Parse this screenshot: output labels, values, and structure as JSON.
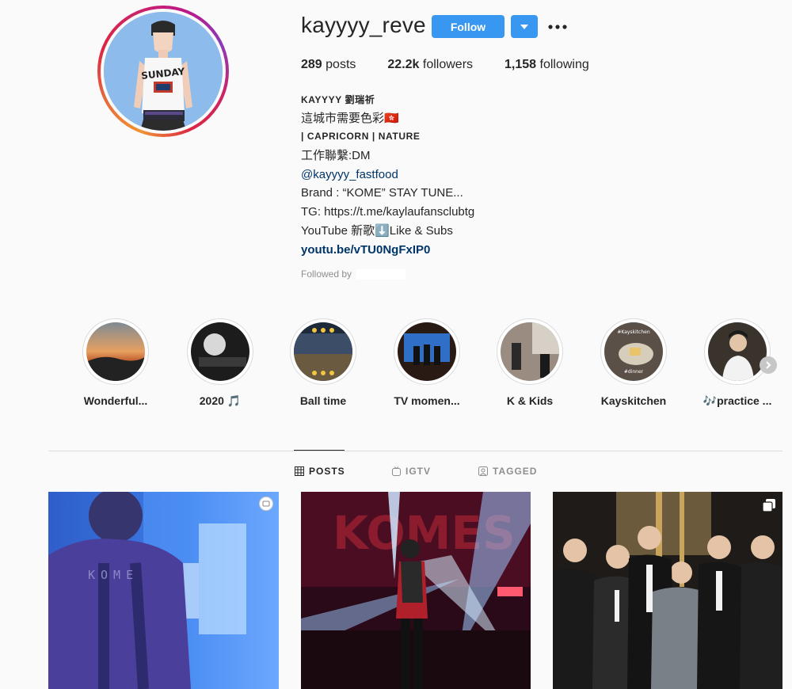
{
  "profile": {
    "username": "kayyyy_reve",
    "follow_label": "Follow",
    "stats": {
      "posts_count": "289",
      "posts_label": " posts",
      "followers_count": "22.2k",
      "followers_label": " followers",
      "following_count": "1,158",
      "following_label": " following"
    },
    "bio": {
      "name": "KAYYYY 劉瑞祈",
      "line1": "這城市需要色彩🇭🇰",
      "line2": "| CAPRICORN | NATURE",
      "line3": "工作聯繫:DM",
      "mention": "@kayyyy_fastfood",
      "line5": "Brand : “KOME” STAY TUNE...",
      "line6": "TG: https://t.me/kaylaufansclubtg",
      "line7": "YouTube 新歌⬇️Like & Subs",
      "link": "youtu.be/vTU0NgFxIP0"
    },
    "followed_by_label": "Followed by"
  },
  "highlights": [
    {
      "label": "Wonderful..."
    },
    {
      "label": "2020 🎵"
    },
    {
      "label": "Ball time"
    },
    {
      "label": "TV momen..."
    },
    {
      "label": "K & Kids"
    },
    {
      "label": "Kayskitchen"
    },
    {
      "label": "🎶practice ..."
    }
  ],
  "tabs": {
    "posts": "POSTS",
    "igtv": "IGTV",
    "tagged": "TAGGED"
  },
  "post_text": {
    "kome_back": "KOME",
    "comes_sign": "KOMES",
    "kitchen_tag": "#Kayskitchen",
    "dinner_tag": "#dinner"
  },
  "colors": {
    "follow_button": "#3897f0",
    "link": "#003569",
    "text": "#262626",
    "muted": "#8e8e8e",
    "background": "#fafafa"
  },
  "icons": [
    "chevron-down-icon",
    "more-dots-icon",
    "grid-icon",
    "igtv-icon",
    "tagged-icon",
    "chevron-right-icon",
    "video-icon",
    "carousel-icon"
  ]
}
